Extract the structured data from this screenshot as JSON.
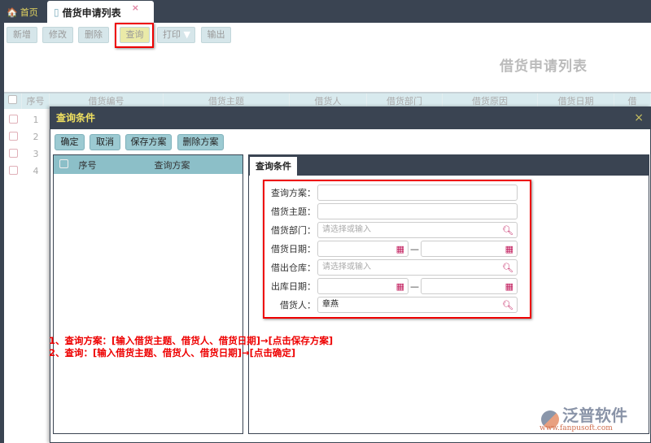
{
  "tabs": {
    "home": "首页",
    "active": "借货申请列表",
    "close": "×"
  },
  "toolbar": [
    "新增",
    "修改",
    "删除",
    "查询",
    "打印",
    "输出"
  ],
  "page_title": "借货申请列表",
  "table": {
    "headers": [
      "序号",
      "借货编号",
      "借货主题",
      "借货人",
      "借货部门",
      "借货原因",
      "借货日期",
      "借"
    ],
    "rows": [
      "1",
      "2",
      "3",
      "4"
    ]
  },
  "dialog": {
    "title": "查询条件",
    "close": "×",
    "buttons": [
      "确定",
      "取消",
      "保存方案",
      "删除方案"
    ],
    "left_headers": [
      "序号",
      "查询方案"
    ],
    "tab": "查询条件",
    "fields": [
      {
        "label": "查询方案：",
        "value": ""
      },
      {
        "label": "借货主题：",
        "value": ""
      },
      {
        "label": "借货部门：",
        "placeholder": "请选择或输入"
      },
      {
        "label": "借货日期：",
        "dash": "—"
      },
      {
        "label": "借出仓库：",
        "placeholder": "请选择或输入"
      },
      {
        "label": "出库日期：",
        "dash": "—"
      },
      {
        "label": "借货人：",
        "value": "章燕"
      }
    ]
  },
  "notes": [
    "1、查询方案：[输入借货主题、借货人、借货日期]→[点击保存方案]",
    "2、查询：[输入借货主题、借货人、借货日期]→[点击确定]"
  ],
  "logo": {
    "name": "泛普软件",
    "url": "www.fanpusoft.com"
  }
}
